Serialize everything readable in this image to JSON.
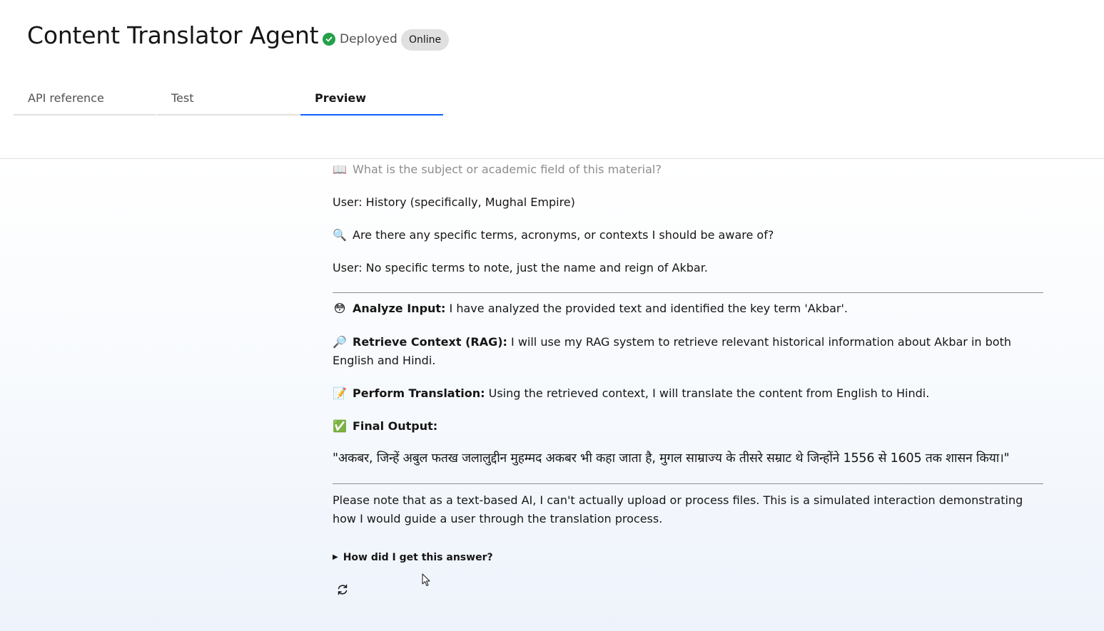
{
  "header": {
    "title": "Content Translator Agent",
    "status_label": "Deployed",
    "badge": "Online"
  },
  "tabs": [
    {
      "label": "API reference",
      "active": false
    },
    {
      "label": "Test",
      "active": false
    },
    {
      "label": "Preview",
      "active": true
    }
  ],
  "chat": {
    "q1_icon": "book-icon",
    "q1": "What is the subject or academic field of this material?",
    "a1": "User: History (specifically, Mughal Empire)",
    "q2_icon": "magnifying-glass-icon",
    "q2": "Are there any specific terms, acronyms, or contexts I should be aware of?",
    "a2": "User: No specific terms to note, just the name and reign of Akbar.",
    "steps": [
      {
        "icon": "face-icon",
        "title": "Analyze Input:",
        "text": " I have analyzed the provided text and identified the key term 'Akbar'."
      },
      {
        "icon": "magnifying-glass-icon",
        "title": "Retrieve Context (RAG):",
        "text": " I will use my RAG system to retrieve relevant historical information about Akbar in both English and Hindi."
      },
      {
        "icon": "memo-icon",
        "title": "Perform Translation:",
        "text": " Using the retrieved context, I will translate the content from English to Hindi."
      },
      {
        "icon": "check-box-icon",
        "title": "Final Output:",
        "text": ""
      }
    ],
    "hindi_output": "\"अकबर, जिन्हें अबुल फतख जलालुद्दीन मुहम्मद अकबर भी कहा जाता है, मुगल साम्राज्य के तीसरे सम्राट थे जिन्होंने 1556 से 1605 तक शासन किया।\"",
    "note": "Please note that as a text-based AI, I can't actually upload or process files. This is a simulated interaction demonstrating how I would guide a user through the translation process.",
    "details_label": "How did I get this answer?"
  },
  "colors": {
    "accent": "#0f62fe",
    "deployed": "#24a148",
    "badge_bg": "#e0e0e0"
  }
}
